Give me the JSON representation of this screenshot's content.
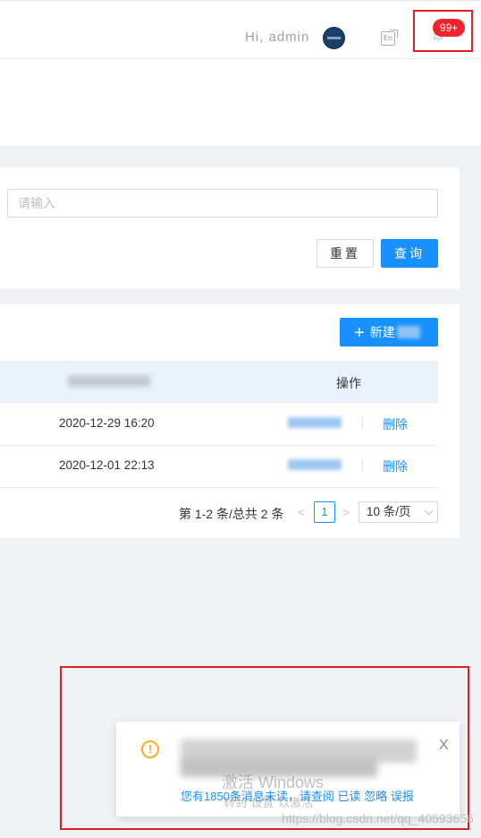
{
  "header": {
    "greeting": "Hi,  admin",
    "lang_icon_text": "En",
    "notification_badge": "99+"
  },
  "search": {
    "placeholder": "请输入",
    "reset_label": "重置",
    "query_label": "查询"
  },
  "table": {
    "new_button_label": "新建",
    "ops_header": "操作",
    "rows": [
      {
        "date": "2020-12-29 16:20",
        "delete_label": "删除"
      },
      {
        "date": "2020-12-01 22:13",
        "delete_label": "删除"
      }
    ]
  },
  "pagination": {
    "total_text": "第 1-2 条/总共 2 条",
    "prev": "<",
    "current_page": "1",
    "next": ">",
    "page_size": "10 条/页"
  },
  "notification": {
    "warn_symbol": "!",
    "close_symbol": "X",
    "message": "您有1850条消息未读，请查阅",
    "action_read": "已读",
    "action_ignore": "忽略",
    "action_report": "误报"
  },
  "watermark": {
    "title": "激活 Windows",
    "subtitle": "转到\"设置\"以激活",
    "url": "https://blog.csdn.net/qq_40593656"
  }
}
